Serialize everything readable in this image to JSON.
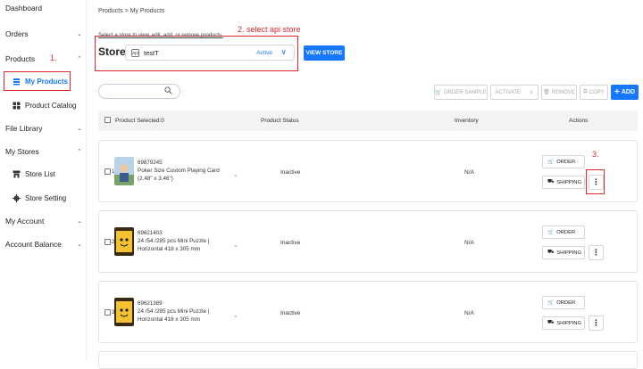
{
  "sidebar": {
    "items": [
      {
        "label": "Dashboard",
        "chev": ""
      },
      {
        "label": "Orders",
        "chev": "⌄"
      },
      {
        "label": "Products",
        "chev": "⌃"
      },
      {
        "label": "File Library",
        "chev": "⌄"
      },
      {
        "label": "My Stores",
        "chev": "⌃"
      },
      {
        "label": "My Account",
        "chev": "⌄"
      },
      {
        "label": "Account Balance",
        "chev": "⌄"
      }
    ],
    "sub": {
      "my_products": "My Products",
      "product_catalog": "Product Catalog",
      "store_list": "Store List",
      "store_setting": "Store Setting"
    }
  },
  "annotations": {
    "step1": "1.",
    "step2": "2. select api store",
    "step3": "3."
  },
  "breadcrumb": "Products > My Products",
  "hint": "Select a store to view, edit, add, or remove products.",
  "store": {
    "label": "Store:",
    "name": "testT",
    "status": "Active",
    "view_button": "VIEW STORE",
    "dropdown": "∨"
  },
  "toolbar": {
    "order_sample": "ORDER SAMPLE",
    "activate": "ACTIVATE",
    "remove": "REMOVE",
    "copy": "COPY",
    "add": "ADD",
    "activate_chev": "∨",
    "add_plus": "+"
  },
  "table": {
    "headers": {
      "product": "Product  Selected:0",
      "status": "Product Status",
      "inventory": "Inventory",
      "actions": "Actions"
    }
  },
  "products": [
    {
      "index": "1",
      "id": "69879245",
      "name": "Poker Size Custom Playing Card (2.48\" x 3.46\")",
      "status": "Inactive",
      "inventory": "N/A",
      "order": "ORDER",
      "shipping": "SHIPPING",
      "more": "⋮"
    },
    {
      "index": "2",
      "id": "69621403",
      "name": "24 /54 /285 pcs Mini Puzzle | Horizontal 418 x 305 mm",
      "status": "Inactive",
      "inventory": "N/A",
      "order": "ORDER",
      "shipping": "SHIPPING",
      "more": "⋮"
    },
    {
      "index": "3",
      "id": "69621389",
      "name": "24 /54 /285 pcs Mini Puzzle | Horizontal 418 x 305 mm",
      "status": "Inactive",
      "inventory": "N/A",
      "order": "ORDER",
      "shipping": "SHIPPING",
      "more": "⋮"
    }
  ],
  "icons": {
    "store_icon": "api",
    "search": "⌕",
    "cart": "🛒",
    "truck": "⛟",
    "trash": "🗑",
    "copy_icon": "⧉",
    "chevron": "⌄"
  },
  "colors": {
    "accent": "#1677ff",
    "annotation": "#e1272d"
  }
}
